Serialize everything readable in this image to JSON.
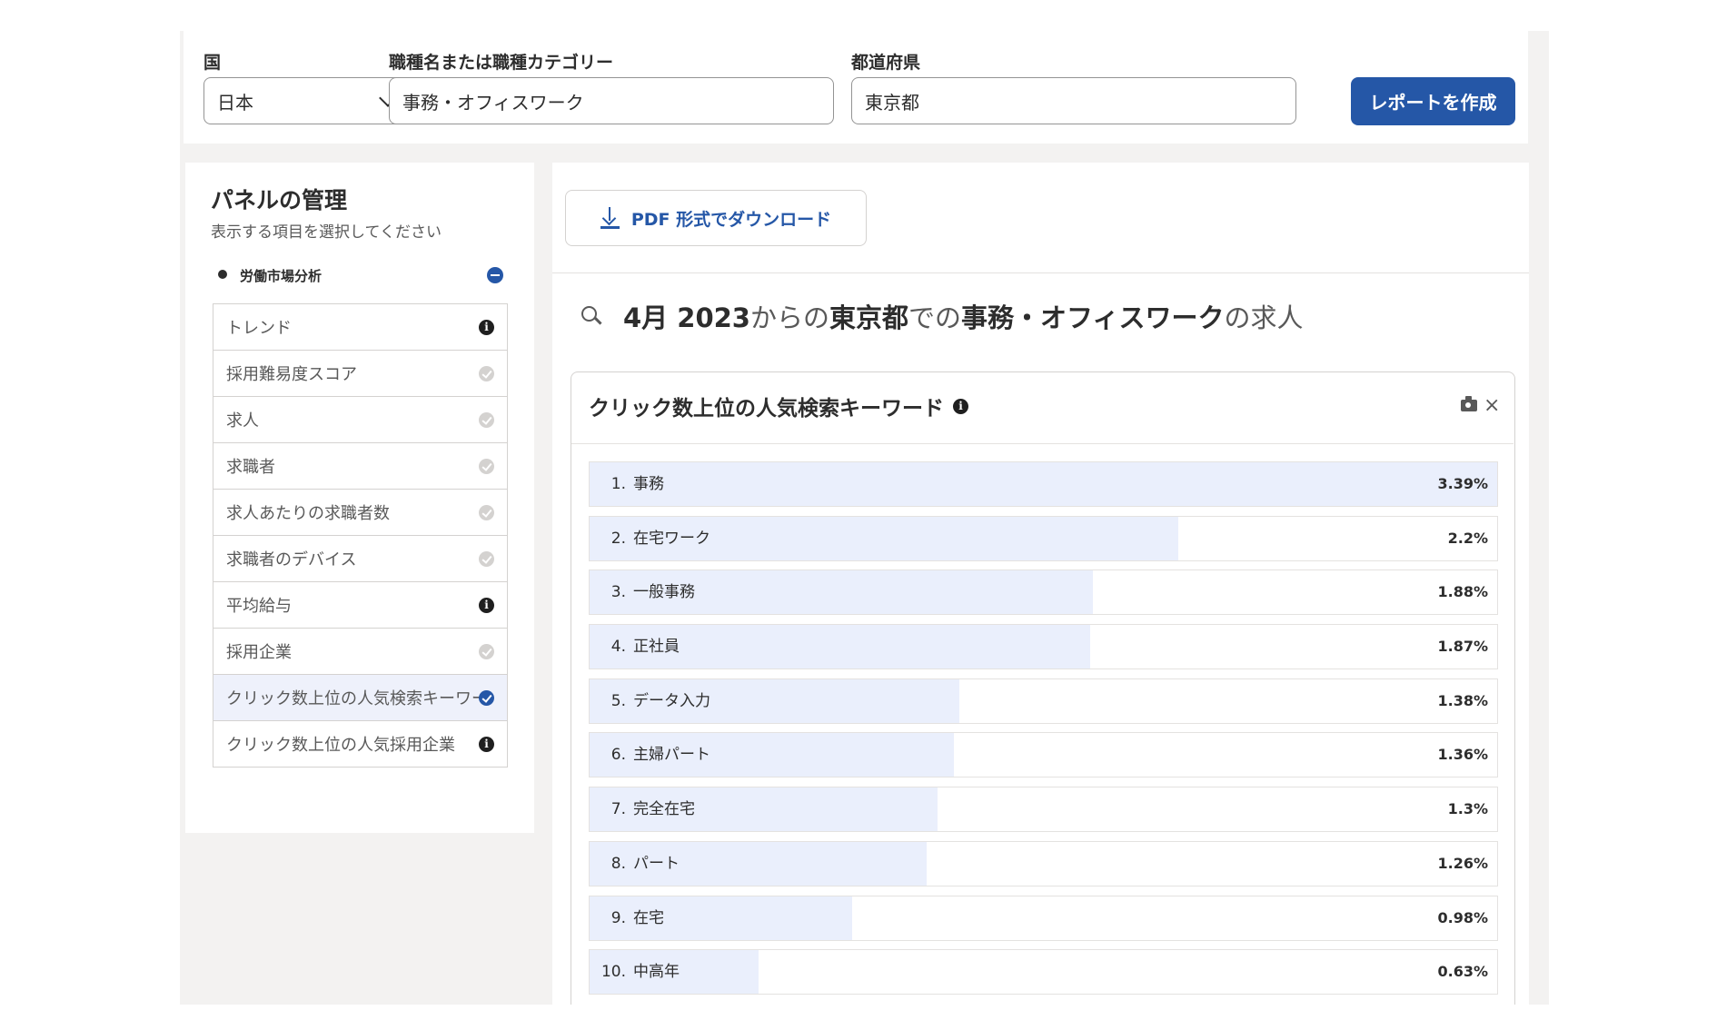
{
  "search": {
    "country_label": "国",
    "country_value": "日本",
    "job_label": "職種名または職種カテゴリー",
    "job_value": "事務・オフィスワーク",
    "prefecture_label": "都道府県",
    "prefecture_value": "東京都",
    "submit_label": "レポートを作成"
  },
  "sidebar": {
    "title": "パネルの管理",
    "subtitle": "表示する項目を選択してください",
    "group_label": "労働市場分析",
    "items": [
      {
        "label": "トレンド",
        "status": "info"
      },
      {
        "label": "採用難易度スコア",
        "status": "check"
      },
      {
        "label": "求人",
        "status": "check"
      },
      {
        "label": "求職者",
        "status": "check"
      },
      {
        "label": "求人あたりの求職者数",
        "status": "check"
      },
      {
        "label": "求職者のデバイス",
        "status": "check"
      },
      {
        "label": "平均給与",
        "status": "info"
      },
      {
        "label": "採用企業",
        "status": "check"
      },
      {
        "label": "クリック数上位の人気検索キーワード",
        "status": "checked"
      },
      {
        "label": "クリック数上位の人気採用企業",
        "status": "info"
      }
    ]
  },
  "main": {
    "pdf_label": "PDF 形式でダウンロード",
    "headline": {
      "part1": "4月 2023",
      "part2": "からの",
      "part3": "東京都",
      "part4": "での",
      "part5": "事務・オフィスワーク",
      "part6": "の求人"
    },
    "card": {
      "title": "クリック数上位の人気検索キーワード",
      "close_glyph": "×",
      "keywords": [
        {
          "rank": "1.",
          "term": "事務",
          "value_label": "3.39%",
          "value": 3.39
        },
        {
          "rank": "2.",
          "term": "在宅ワーク",
          "value_label": "2.2%",
          "value": 2.2
        },
        {
          "rank": "3.",
          "term": "一般事務",
          "value_label": "1.88%",
          "value": 1.88
        },
        {
          "rank": "4.",
          "term": "正社員",
          "value_label": "1.87%",
          "value": 1.87
        },
        {
          "rank": "5.",
          "term": "データ入力",
          "value_label": "1.38%",
          "value": 1.38
        },
        {
          "rank": "6.",
          "term": "主婦パート",
          "value_label": "1.36%",
          "value": 1.36
        },
        {
          "rank": "7.",
          "term": "完全在宅",
          "value_label": "1.3%",
          "value": 1.3
        },
        {
          "rank": "8.",
          "term": "パート",
          "value_label": "1.26%",
          "value": 1.26
        },
        {
          "rank": "9.",
          "term": "在宅",
          "value_label": "0.98%",
          "value": 0.98
        },
        {
          "rank": "10.",
          "term": "中高年",
          "value_label": "0.63%",
          "value": 0.63
        }
      ]
    }
  },
  "colors": {
    "accent": "#2557a7",
    "bar_fill": "#eaeffc",
    "background": "#f3f2f1"
  }
}
